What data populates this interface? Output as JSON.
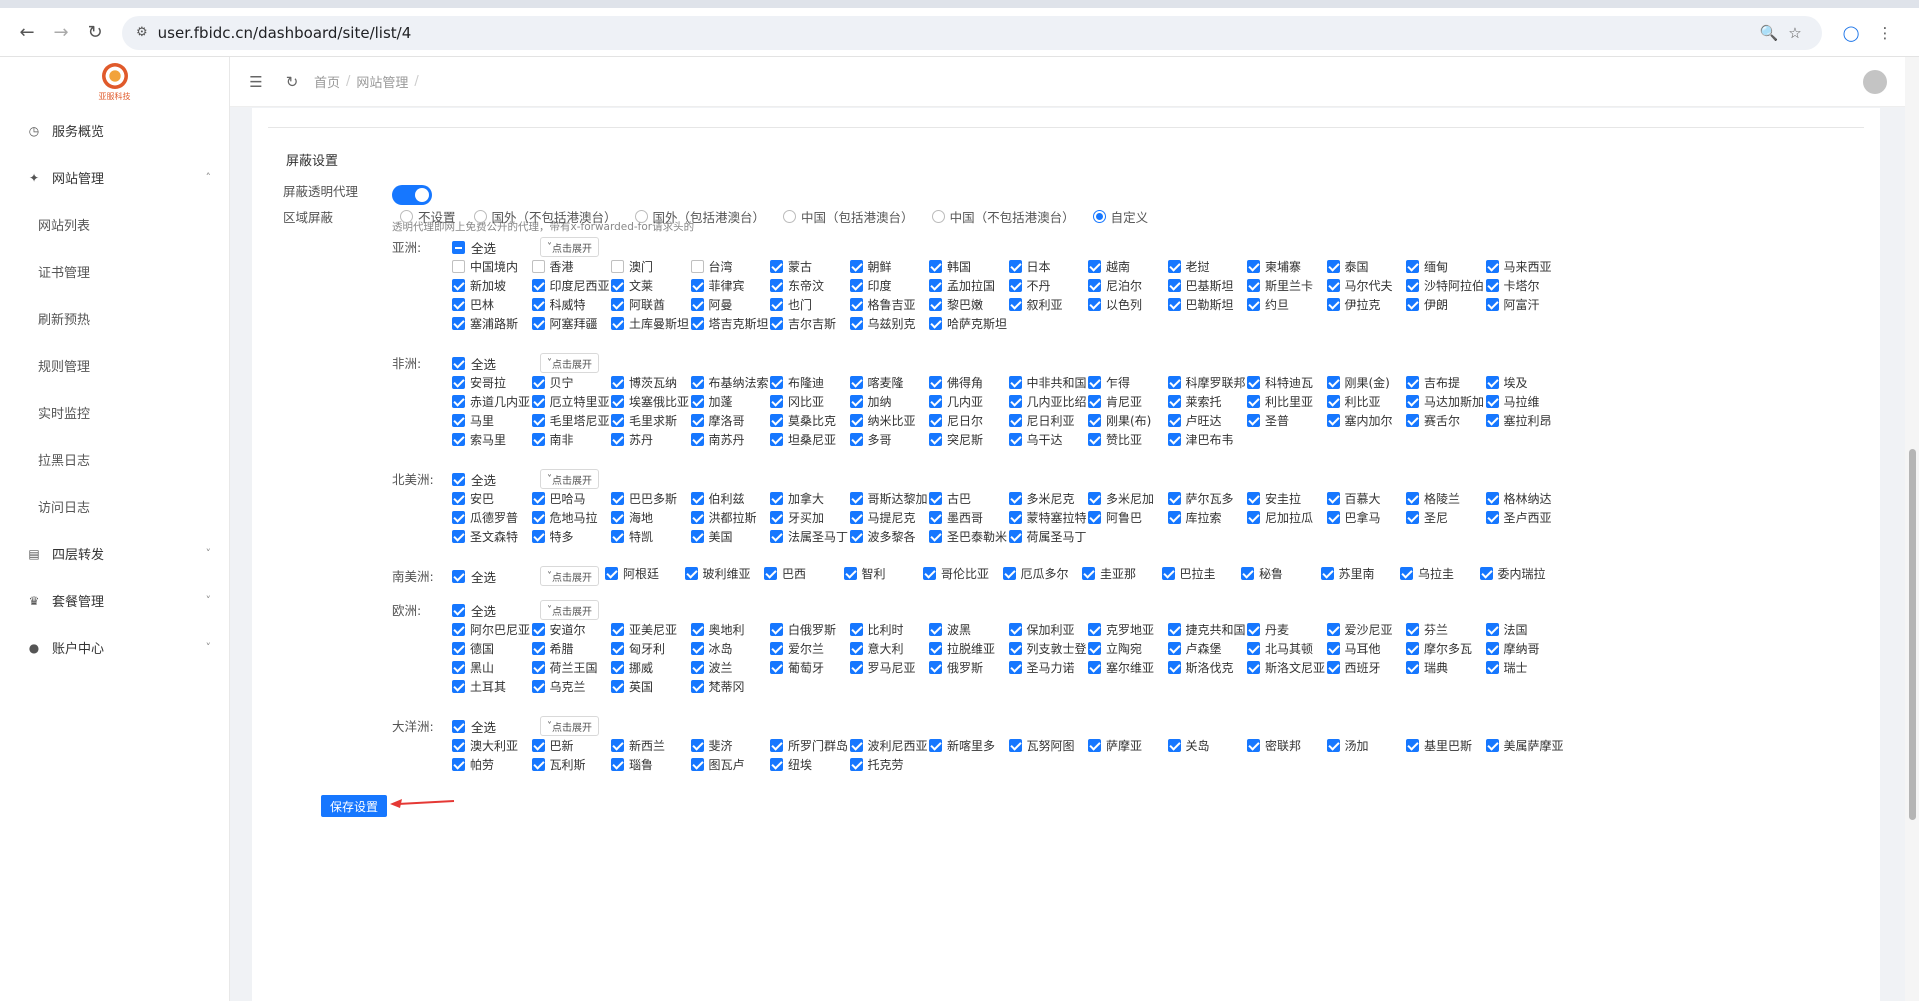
{
  "browser": {
    "url": "user.fbidc.cn/dashboard/site/list/4"
  },
  "sidebar": {
    "logo_text": "亚服科技",
    "items": [
      {
        "label": "服务概览",
        "icon": "clock-icon",
        "type": "item"
      },
      {
        "label": "网站管理",
        "icon": "link-icon",
        "type": "group",
        "expanded": true
      },
      {
        "label": "网站列表",
        "type": "sub"
      },
      {
        "label": "证书管理",
        "type": "sub"
      },
      {
        "label": "刷新预热",
        "type": "sub"
      },
      {
        "label": "规则管理",
        "type": "sub"
      },
      {
        "label": "实时监控",
        "type": "sub"
      },
      {
        "label": "拉黑日志",
        "type": "sub"
      },
      {
        "label": "访问日志",
        "type": "sub"
      },
      {
        "label": "四层转发",
        "icon": "server-icon",
        "type": "group",
        "expanded": false
      },
      {
        "label": "套餐管理",
        "icon": "crown-icon",
        "type": "group",
        "expanded": false
      },
      {
        "label": "账户中心",
        "icon": "user-icon",
        "type": "group",
        "expanded": false
      }
    ]
  },
  "header": {
    "crumbs": [
      "首页",
      "网站管理"
    ]
  },
  "settings": {
    "section_title": "屏蔽设置",
    "proxy_label": "屏蔽透明代理",
    "proxy_enabled": true,
    "proxy_hint": "透明代理即网上免费公开的代理，带有x-forwarded-for请求头的",
    "region_label": "区域屏蔽",
    "radio_options": [
      "不设置",
      "国外（不包括港澳台）",
      "国外（包括港澳台）",
      "中国（包括港澳台）",
      "中国（不包括港澳台）",
      "自定义"
    ],
    "radio_selected": 5,
    "all_label": "全选",
    "expand_label": "点击展开",
    "save_label": "保存设置"
  },
  "regions": [
    {
      "name": "亚洲:",
      "all_state": "indeterminate",
      "countries": [
        {
          "n": "中国境内",
          "c": false
        },
        {
          "n": "香港",
          "c": false
        },
        {
          "n": "澳门",
          "c": false
        },
        {
          "n": "台湾",
          "c": false
        },
        {
          "n": "蒙古",
          "c": true
        },
        {
          "n": "朝鲜",
          "c": true
        },
        {
          "n": "韩国",
          "c": true
        },
        {
          "n": "日本",
          "c": true
        },
        {
          "n": "越南",
          "c": true
        },
        {
          "n": "老挝",
          "c": true
        },
        {
          "n": "柬埔寨",
          "c": true
        },
        {
          "n": "泰国",
          "c": true
        },
        {
          "n": "缅甸",
          "c": true
        },
        {
          "n": "马来西亚",
          "c": true
        },
        {
          "n": "新加坡",
          "c": true
        },
        {
          "n": "印度尼西亚",
          "c": true
        },
        {
          "n": "文莱",
          "c": true
        },
        {
          "n": "菲律宾",
          "c": true
        },
        {
          "n": "东帝汶",
          "c": true
        },
        {
          "n": "印度",
          "c": true
        },
        {
          "n": "孟加拉国",
          "c": true
        },
        {
          "n": "不丹",
          "c": true
        },
        {
          "n": "尼泊尔",
          "c": true
        },
        {
          "n": "巴基斯坦",
          "c": true
        },
        {
          "n": "斯里兰卡",
          "c": true
        },
        {
          "n": "马尔代夫",
          "c": true
        },
        {
          "n": "沙特阿拉伯",
          "c": true
        },
        {
          "n": "卡塔尔",
          "c": true
        },
        {
          "n": "巴林",
          "c": true
        },
        {
          "n": "科威特",
          "c": true
        },
        {
          "n": "阿联酋",
          "c": true
        },
        {
          "n": "阿曼",
          "c": true
        },
        {
          "n": "也门",
          "c": true
        },
        {
          "n": "格鲁吉亚",
          "c": true
        },
        {
          "n": "黎巴嫩",
          "c": true
        },
        {
          "n": "叙利亚",
          "c": true
        },
        {
          "n": "以色列",
          "c": true
        },
        {
          "n": "巴勒斯坦",
          "c": true
        },
        {
          "n": "约旦",
          "c": true
        },
        {
          "n": "伊拉克",
          "c": true
        },
        {
          "n": "伊朗",
          "c": true
        },
        {
          "n": "阿富汗",
          "c": true
        },
        {
          "n": "塞浦路斯",
          "c": true
        },
        {
          "n": "阿塞拜疆",
          "c": true
        },
        {
          "n": "土库曼斯坦",
          "c": true
        },
        {
          "n": "塔吉克斯坦",
          "c": true
        },
        {
          "n": "吉尔吉斯",
          "c": true
        },
        {
          "n": "乌兹别克",
          "c": true
        },
        {
          "n": "哈萨克斯坦",
          "c": true
        }
      ]
    },
    {
      "name": "非洲:",
      "all_state": "checked",
      "countries": [
        {
          "n": "安哥拉",
          "c": true
        },
        {
          "n": "贝宁",
          "c": true
        },
        {
          "n": "博茨瓦纳",
          "c": true
        },
        {
          "n": "布基纳法索",
          "c": true
        },
        {
          "n": "布隆迪",
          "c": true
        },
        {
          "n": "喀麦隆",
          "c": true
        },
        {
          "n": "佛得角",
          "c": true
        },
        {
          "n": "中非共和国",
          "c": true
        },
        {
          "n": "乍得",
          "c": true
        },
        {
          "n": "科摩罗联邦",
          "c": true
        },
        {
          "n": "科特迪瓦",
          "c": true
        },
        {
          "n": "刚果(金)",
          "c": true
        },
        {
          "n": "吉布提",
          "c": true
        },
        {
          "n": "埃及",
          "c": true
        },
        {
          "n": "赤道几内亚",
          "c": true
        },
        {
          "n": "厄立特里亚",
          "c": true
        },
        {
          "n": "埃塞俄比亚",
          "c": true
        },
        {
          "n": "加蓬",
          "c": true
        },
        {
          "n": "冈比亚",
          "c": true
        },
        {
          "n": "加纳",
          "c": true
        },
        {
          "n": "几内亚",
          "c": true
        },
        {
          "n": "几内亚比绍",
          "c": true
        },
        {
          "n": "肯尼亚",
          "c": true
        },
        {
          "n": "莱索托",
          "c": true
        },
        {
          "n": "利比里亚",
          "c": true
        },
        {
          "n": "利比亚",
          "c": true
        },
        {
          "n": "马达加斯加",
          "c": true
        },
        {
          "n": "马拉维",
          "c": true
        },
        {
          "n": "马里",
          "c": true
        },
        {
          "n": "毛里塔尼亚",
          "c": true
        },
        {
          "n": "毛里求斯",
          "c": true
        },
        {
          "n": "摩洛哥",
          "c": true
        },
        {
          "n": "莫桑比克",
          "c": true
        },
        {
          "n": "纳米比亚",
          "c": true
        },
        {
          "n": "尼日尔",
          "c": true
        },
        {
          "n": "尼日利亚",
          "c": true
        },
        {
          "n": "刚果(布)",
          "c": true
        },
        {
          "n": "卢旺达",
          "c": true
        },
        {
          "n": "圣普",
          "c": true
        },
        {
          "n": "塞内加尔",
          "c": true
        },
        {
          "n": "赛舌尔",
          "c": true
        },
        {
          "n": "塞拉利昂",
          "c": true
        },
        {
          "n": "索马里",
          "c": true
        },
        {
          "n": "南非",
          "c": true
        },
        {
          "n": "苏丹",
          "c": true
        },
        {
          "n": "南苏丹",
          "c": true
        },
        {
          "n": "坦桑尼亚",
          "c": true
        },
        {
          "n": "多哥",
          "c": true
        },
        {
          "n": "突尼斯",
          "c": true
        },
        {
          "n": "乌干达",
          "c": true
        },
        {
          "n": "赞比亚",
          "c": true
        },
        {
          "n": "津巴布韦",
          "c": true
        }
      ]
    },
    {
      "name": "北美洲:",
      "all_state": "checked",
      "countries": [
        {
          "n": "安巴",
          "c": true
        },
        {
          "n": "巴哈马",
          "c": true
        },
        {
          "n": "巴巴多斯",
          "c": true
        },
        {
          "n": "伯利兹",
          "c": true
        },
        {
          "n": "加拿大",
          "c": true
        },
        {
          "n": "哥斯达黎加",
          "c": true
        },
        {
          "n": "古巴",
          "c": true
        },
        {
          "n": "多米尼克",
          "c": true
        },
        {
          "n": "多米尼加",
          "c": true
        },
        {
          "n": "萨尔瓦多",
          "c": true
        },
        {
          "n": "安圭拉",
          "c": true
        },
        {
          "n": "百慕大",
          "c": true
        },
        {
          "n": "格陵兰",
          "c": true
        },
        {
          "n": "格林纳达",
          "c": true
        },
        {
          "n": "瓜德罗普",
          "c": true
        },
        {
          "n": "危地马拉",
          "c": true
        },
        {
          "n": "海地",
          "c": true
        },
        {
          "n": "洪都拉斯",
          "c": true
        },
        {
          "n": "牙买加",
          "c": true
        },
        {
          "n": "马提尼克",
          "c": true
        },
        {
          "n": "墨西哥",
          "c": true
        },
        {
          "n": "蒙特塞拉特",
          "c": true
        },
        {
          "n": "阿鲁巴",
          "c": true
        },
        {
          "n": "库拉索",
          "c": true
        },
        {
          "n": "尼加拉瓜",
          "c": true
        },
        {
          "n": "巴拿马",
          "c": true
        },
        {
          "n": "圣尼",
          "c": true
        },
        {
          "n": "圣卢西亚",
          "c": true
        },
        {
          "n": "圣文森特",
          "c": true
        },
        {
          "n": "特多",
          "c": true
        },
        {
          "n": "特凯",
          "c": true
        },
        {
          "n": "美国",
          "c": true
        },
        {
          "n": "法属圣马丁",
          "c": true
        },
        {
          "n": "波多黎各",
          "c": true
        },
        {
          "n": "圣巴泰勒米",
          "c": true
        },
        {
          "n": "荷属圣马丁",
          "c": true
        }
      ]
    },
    {
      "name": "南美洲:",
      "all_state": "checked",
      "countries": [
        {
          "n": "阿根廷",
          "c": true
        },
        {
          "n": "玻利维亚",
          "c": true
        },
        {
          "n": "巴西",
          "c": true
        },
        {
          "n": "智利",
          "c": true
        },
        {
          "n": "哥伦比亚",
          "c": true
        },
        {
          "n": "厄瓜多尔",
          "c": true
        },
        {
          "n": "圭亚那",
          "c": true
        },
        {
          "n": "巴拉圭",
          "c": true
        },
        {
          "n": "秘鲁",
          "c": true
        },
        {
          "n": "苏里南",
          "c": true
        },
        {
          "n": "乌拉圭",
          "c": true
        },
        {
          "n": "委内瑞拉",
          "c": true
        }
      ]
    },
    {
      "name": "欧洲:",
      "all_state": "checked",
      "countries": [
        {
          "n": "阿尔巴尼亚",
          "c": true
        },
        {
          "n": "安道尔",
          "c": true
        },
        {
          "n": "亚美尼亚",
          "c": true
        },
        {
          "n": "奥地利",
          "c": true
        },
        {
          "n": "白俄罗斯",
          "c": true
        },
        {
          "n": "比利时",
          "c": true
        },
        {
          "n": "波黑",
          "c": true
        },
        {
          "n": "保加利亚",
          "c": true
        },
        {
          "n": "克罗地亚",
          "c": true
        },
        {
          "n": "捷克共和国",
          "c": true
        },
        {
          "n": "丹麦",
          "c": true
        },
        {
          "n": "爱沙尼亚",
          "c": true
        },
        {
          "n": "芬兰",
          "c": true
        },
        {
          "n": "法国",
          "c": true
        },
        {
          "n": "德国",
          "c": true
        },
        {
          "n": "希腊",
          "c": true
        },
        {
          "n": "匈牙利",
          "c": true
        },
        {
          "n": "冰岛",
          "c": true
        },
        {
          "n": "爱尔兰",
          "c": true
        },
        {
          "n": "意大利",
          "c": true
        },
        {
          "n": "拉脱维亚",
          "c": true
        },
        {
          "n": "列支敦士登",
          "c": true
        },
        {
          "n": "立陶宛",
          "c": true
        },
        {
          "n": "卢森堡",
          "c": true
        },
        {
          "n": "北马其顿",
          "c": true
        },
        {
          "n": "马耳他",
          "c": true
        },
        {
          "n": "摩尔多瓦",
          "c": true
        },
        {
          "n": "摩纳哥",
          "c": true
        },
        {
          "n": "黑山",
          "c": true
        },
        {
          "n": "荷兰王国",
          "c": true
        },
        {
          "n": "挪威",
          "c": true
        },
        {
          "n": "波兰",
          "c": true
        },
        {
          "n": "葡萄牙",
          "c": true
        },
        {
          "n": "罗马尼亚",
          "c": true
        },
        {
          "n": "俄罗斯",
          "c": true
        },
        {
          "n": "圣马力诺",
          "c": true
        },
        {
          "n": "塞尔维亚",
          "c": true
        },
        {
          "n": "斯洛伐克",
          "c": true
        },
        {
          "n": "斯洛文尼亚",
          "c": true
        },
        {
          "n": "西班牙",
          "c": true
        },
        {
          "n": "瑞典",
          "c": true
        },
        {
          "n": "瑞士",
          "c": true
        },
        {
          "n": "土耳其",
          "c": true
        },
        {
          "n": "乌克兰",
          "c": true
        },
        {
          "n": "英国",
          "c": true
        },
        {
          "n": "梵蒂冈",
          "c": true
        }
      ]
    },
    {
      "name": "大洋洲:",
      "all_state": "checked",
      "countries": [
        {
          "n": "澳大利亚",
          "c": true
        },
        {
          "n": "巴新",
          "c": true
        },
        {
          "n": "新西兰",
          "c": true
        },
        {
          "n": "斐济",
          "c": true
        },
        {
          "n": "所罗门群岛",
          "c": true
        },
        {
          "n": "波利尼西亚",
          "c": true
        },
        {
          "n": "新喀里多",
          "c": true
        },
        {
          "n": "瓦努阿图",
          "c": true
        },
        {
          "n": "萨摩亚",
          "c": true
        },
        {
          "n": "关岛",
          "c": true
        },
        {
          "n": "密联邦",
          "c": true
        },
        {
          "n": "汤加",
          "c": true
        },
        {
          "n": "基里巴斯",
          "c": true
        },
        {
          "n": "美属萨摩亚",
          "c": true
        },
        {
          "n": "帕劳",
          "c": true
        },
        {
          "n": "瓦利斯",
          "c": true
        },
        {
          "n": "瑙鲁",
          "c": true
        },
        {
          "n": "图瓦卢",
          "c": true
        },
        {
          "n": "纽埃",
          "c": true
        },
        {
          "n": "托克劳",
          "c": true
        }
      ]
    }
  ]
}
